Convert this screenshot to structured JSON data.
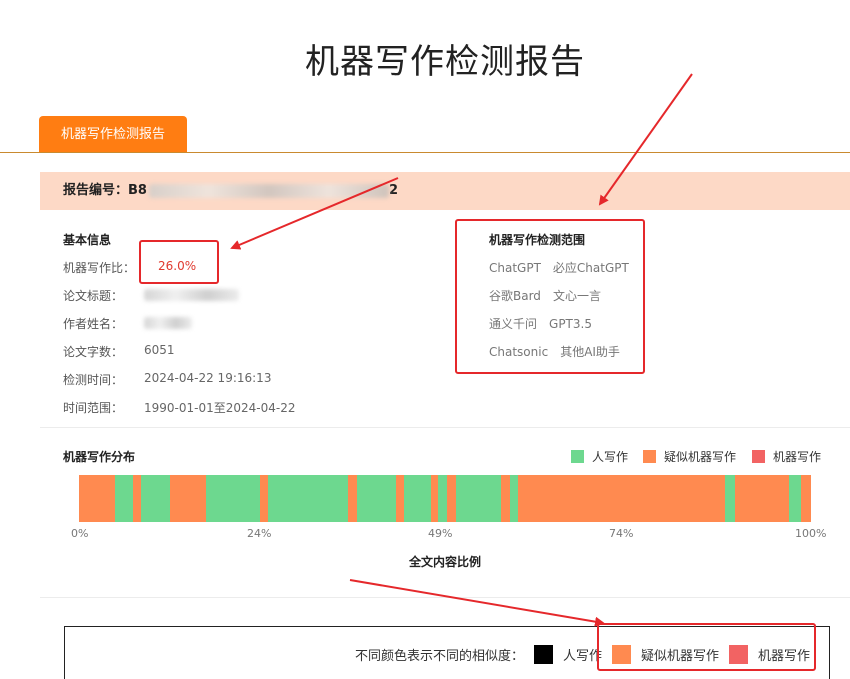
{
  "page": {
    "title": "机器写作检测报告"
  },
  "tab": {
    "label": "机器写作检测报告"
  },
  "report": {
    "id_label": "报告编号：",
    "id_value_visible": "B8",
    "id_value_tail": "2"
  },
  "basic_info": {
    "heading": "基本信息",
    "rows": [
      {
        "label": "机器写作比：",
        "value": "26.0%"
      },
      {
        "label": "论文标题：",
        "value": ""
      },
      {
        "label": "作者姓名：",
        "value": ""
      },
      {
        "label": "论文字数：",
        "value": "6051"
      },
      {
        "label": "检测时间：",
        "value": "2024-04-22 19:16:13"
      },
      {
        "label": "时间范围：",
        "value": "1990-01-01至2024-04-22"
      }
    ]
  },
  "scope": {
    "heading": "机器写作检测范围",
    "rows": [
      [
        "ChatGPT",
        "必应ChatGPT"
      ],
      [
        "谷歌Bard",
        "文心一言"
      ],
      [
        "通义千问",
        "GPT3.5"
      ],
      [
        "Chatsonic",
        "其他AI助手"
      ]
    ]
  },
  "distribution": {
    "heading": "机器写作分布",
    "legend": [
      {
        "label": "人写作",
        "color": "#6dd88f"
      },
      {
        "label": "疑似机器写作",
        "color": "#ff8a50"
      },
      {
        "label": "机器写作",
        "color": "#f26363"
      }
    ]
  },
  "chart_data": {
    "type": "bar",
    "title": "机器写作分布",
    "xlabel": "全文内容比例",
    "ticks": [
      "0%",
      "24%",
      "49%",
      "74%",
      "100%"
    ],
    "segments": [
      {
        "start": 0.0,
        "end": 4.9,
        "class": "疑似机器写作"
      },
      {
        "start": 4.9,
        "end": 7.4,
        "class": "人写作"
      },
      {
        "start": 7.4,
        "end": 8.5,
        "class": "疑似机器写作"
      },
      {
        "start": 8.5,
        "end": 12.4,
        "class": "人写作"
      },
      {
        "start": 12.4,
        "end": 17.3,
        "class": "疑似机器写作"
      },
      {
        "start": 17.3,
        "end": 24.7,
        "class": "人写作"
      },
      {
        "start": 24.7,
        "end": 25.8,
        "class": "疑似机器写作"
      },
      {
        "start": 25.8,
        "end": 36.8,
        "class": "人写作"
      },
      {
        "start": 36.8,
        "end": 38.0,
        "class": "疑似机器写作"
      },
      {
        "start": 38.0,
        "end": 43.3,
        "class": "人写作"
      },
      {
        "start": 43.3,
        "end": 44.4,
        "class": "疑似机器写作"
      },
      {
        "start": 44.4,
        "end": 48.1,
        "class": "人写作"
      },
      {
        "start": 48.1,
        "end": 49.0,
        "class": "疑似机器写作"
      },
      {
        "start": 49.0,
        "end": 50.3,
        "class": "人写作"
      },
      {
        "start": 50.3,
        "end": 51.5,
        "class": "疑似机器写作"
      },
      {
        "start": 51.5,
        "end": 57.7,
        "class": "人写作"
      },
      {
        "start": 57.7,
        "end": 58.9,
        "class": "疑似机器写作"
      },
      {
        "start": 58.9,
        "end": 60.0,
        "class": "人写作"
      },
      {
        "start": 60.0,
        "end": 88.3,
        "class": "疑似机器写作"
      },
      {
        "start": 88.3,
        "end": 89.6,
        "class": "人写作"
      },
      {
        "start": 89.6,
        "end": 97.0,
        "class": "疑似机器写作"
      },
      {
        "start": 97.0,
        "end": 98.6,
        "class": "人写作"
      },
      {
        "start": 98.6,
        "end": 100.0,
        "class": "疑似机器写作"
      }
    ]
  },
  "bottom_legend": {
    "prefix": "不同颜色表示不同的相似度：",
    "items": [
      {
        "label": "人写作",
        "color": "#000000"
      },
      {
        "label": "疑似机器写作",
        "color": "#ff8a50"
      },
      {
        "label": "机器写作",
        "color": "#f26363"
      }
    ]
  },
  "colors": {
    "accent": "#ff7d12",
    "annotation": "#e5282b"
  }
}
